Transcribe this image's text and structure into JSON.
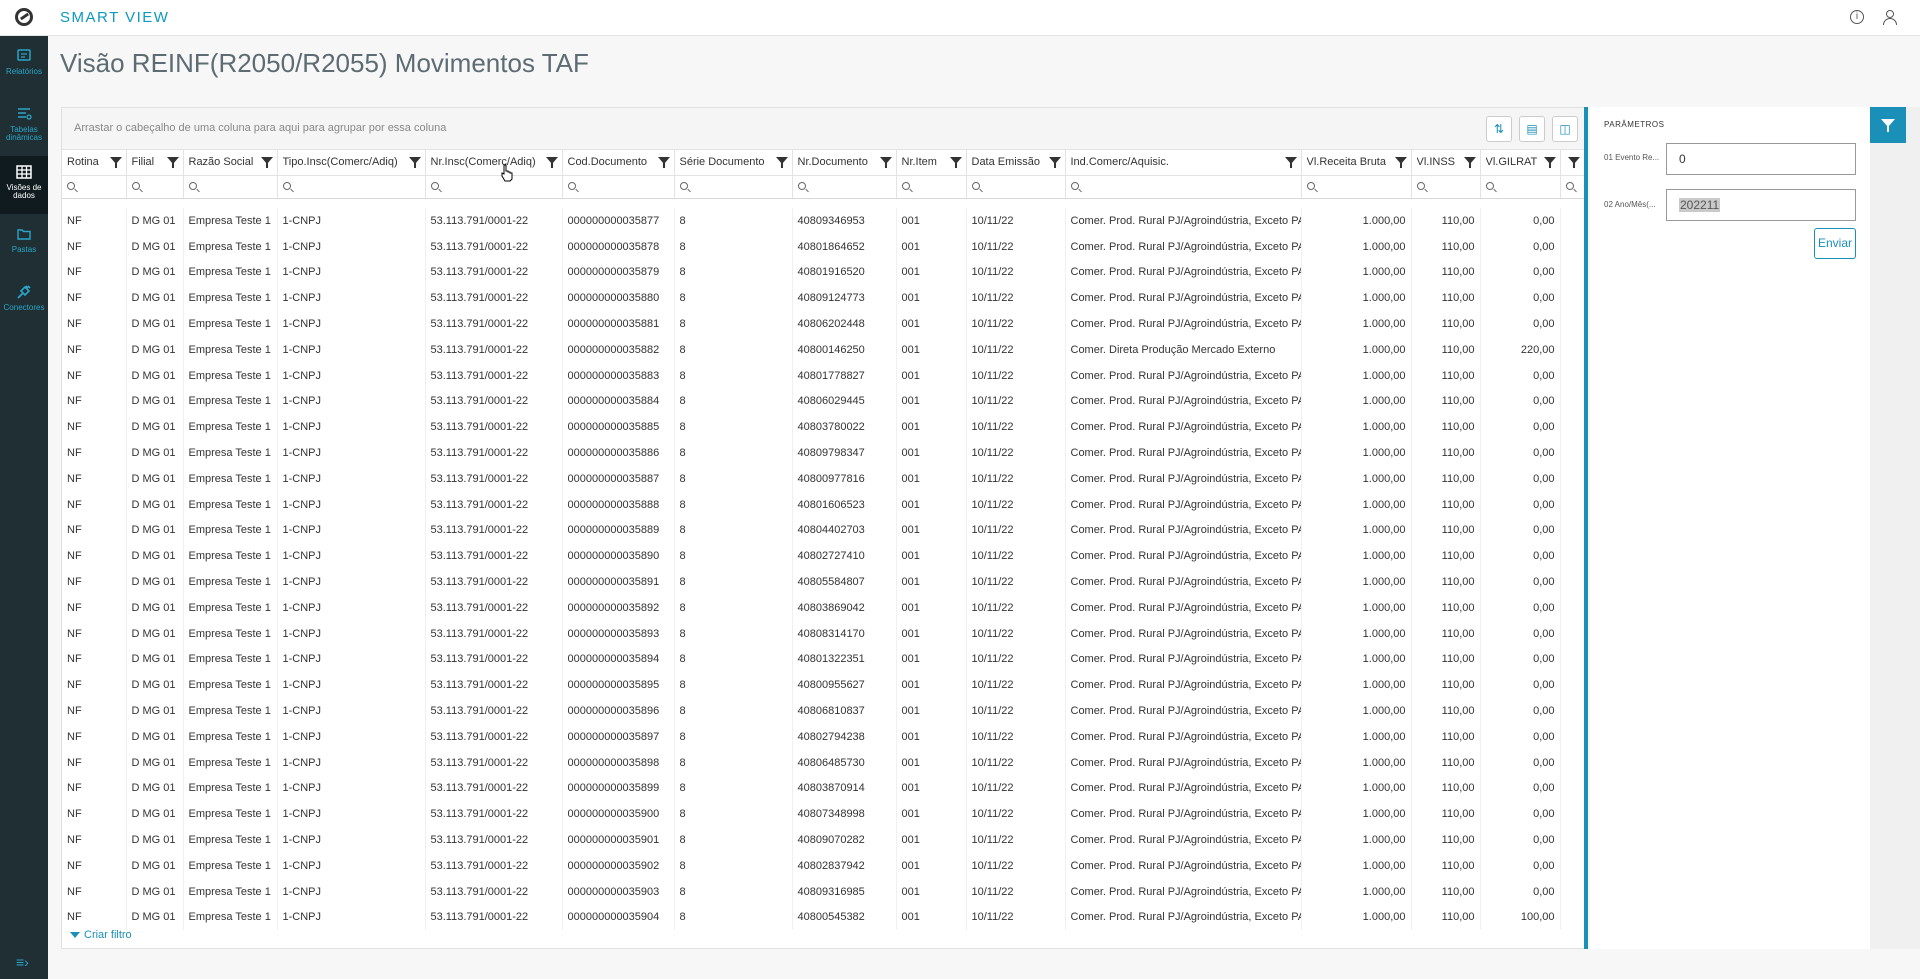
{
  "app": {
    "brand": "SMART VIEW",
    "info_icon": "info-icon",
    "user_icon": "user-icon"
  },
  "sidebar": {
    "items": [
      {
        "label": "Relatórios",
        "icon": "report-icon"
      },
      {
        "label": "Tabelas dinâmicas",
        "icon": "pivot-table-icon"
      },
      {
        "label": "Visões de dados",
        "icon": "grid-icon"
      },
      {
        "label": "Pastas",
        "icon": "folder-icon"
      },
      {
        "label": "Conectores",
        "icon": "plug-icon"
      }
    ],
    "collapse_icon": "collapse-menu-icon"
  },
  "page": {
    "title": "Visão REINF(R2050/R2055) Movimentos TAF"
  },
  "grid": {
    "group_hint": "Arrastar o cabeçalho de uma coluna para aqui para agrupar por essa coluna",
    "columns": [
      "Rotina",
      "Filial",
      "Razão Social",
      "Tipo.Insc(Comerc/Adiq)",
      "Nr.Insc(Comerc/Adiq)",
      "Cod.Documento",
      "Série Documento",
      "Nr.Documento",
      "Nr.Item",
      "Data Emissão",
      "Ind.Comerc/Aquisic.",
      "Vl.Receita Bruta",
      "Vl.INSS",
      "Vl.GILRAT"
    ],
    "rows": [
      [
        "NF",
        "D MG 01",
        "Empresa Teste 1",
        "1-CNPJ",
        "53.113.791/0001-22",
        "000000000035877",
        "8",
        "40809346953",
        "001",
        "10/11/22",
        "Comer. Prod. Rural PJ/Agroindústria, Exceto PAA;",
        "1.000,00",
        "110,00",
        "0,00"
      ],
      [
        "NF",
        "D MG 01",
        "Empresa Teste 1",
        "1-CNPJ",
        "53.113.791/0001-22",
        "000000000035878",
        "8",
        "40801864652",
        "001",
        "10/11/22",
        "Comer. Prod. Rural PJ/Agroindústria, Exceto PAA;",
        "1.000,00",
        "110,00",
        "0,00"
      ],
      [
        "NF",
        "D MG 01",
        "Empresa Teste 1",
        "1-CNPJ",
        "53.113.791/0001-22",
        "000000000035879",
        "8",
        "40801916520",
        "001",
        "10/11/22",
        "Comer. Prod. Rural PJ/Agroindústria, Exceto PAA;",
        "1.000,00",
        "110,00",
        "0,00"
      ],
      [
        "NF",
        "D MG 01",
        "Empresa Teste 1",
        "1-CNPJ",
        "53.113.791/0001-22",
        "000000000035880",
        "8",
        "40809124773",
        "001",
        "10/11/22",
        "Comer. Prod. Rural PJ/Agroindústria, Exceto PAA;",
        "1.000,00",
        "110,00",
        "0,00"
      ],
      [
        "NF",
        "D MG 01",
        "Empresa Teste 1",
        "1-CNPJ",
        "53.113.791/0001-22",
        "000000000035881",
        "8",
        "40806202448",
        "001",
        "10/11/22",
        "Comer. Prod. Rural PJ/Agroindústria, Exceto PAA;",
        "1.000,00",
        "110,00",
        "0,00"
      ],
      [
        "NF",
        "D MG 01",
        "Empresa Teste 1",
        "1-CNPJ",
        "53.113.791/0001-22",
        "000000000035882",
        "8",
        "40800146250",
        "001",
        "10/11/22",
        "Comer. Direta Produção Mercado Externo",
        "1.000,00",
        "110,00",
        "220,00"
      ],
      [
        "NF",
        "D MG 01",
        "Empresa Teste 1",
        "1-CNPJ",
        "53.113.791/0001-22",
        "000000000035883",
        "8",
        "40801778827",
        "001",
        "10/11/22",
        "Comer. Prod. Rural PJ/Agroindústria, Exceto PAA;",
        "1.000,00",
        "110,00",
        "0,00"
      ],
      [
        "NF",
        "D MG 01",
        "Empresa Teste 1",
        "1-CNPJ",
        "53.113.791/0001-22",
        "000000000035884",
        "8",
        "40806029445",
        "001",
        "10/11/22",
        "Comer. Prod. Rural PJ/Agroindústria, Exceto PAA;",
        "1.000,00",
        "110,00",
        "0,00"
      ],
      [
        "NF",
        "D MG 01",
        "Empresa Teste 1",
        "1-CNPJ",
        "53.113.791/0001-22",
        "000000000035885",
        "8",
        "40803780022",
        "001",
        "10/11/22",
        "Comer. Prod. Rural PJ/Agroindústria, Exceto PAA;",
        "1.000,00",
        "110,00",
        "0,00"
      ],
      [
        "NF",
        "D MG 01",
        "Empresa Teste 1",
        "1-CNPJ",
        "53.113.791/0001-22",
        "000000000035886",
        "8",
        "40809798347",
        "001",
        "10/11/22",
        "Comer. Prod. Rural PJ/Agroindústria, Exceto PAA;",
        "1.000,00",
        "110,00",
        "0,00"
      ],
      [
        "NF",
        "D MG 01",
        "Empresa Teste 1",
        "1-CNPJ",
        "53.113.791/0001-22",
        "000000000035887",
        "8",
        "40800977816",
        "001",
        "10/11/22",
        "Comer. Prod. Rural PJ/Agroindústria, Exceto PAA;",
        "1.000,00",
        "110,00",
        "0,00"
      ],
      [
        "NF",
        "D MG 01",
        "Empresa Teste 1",
        "1-CNPJ",
        "53.113.791/0001-22",
        "000000000035888",
        "8",
        "40801606523",
        "001",
        "10/11/22",
        "Comer. Prod. Rural PJ/Agroindústria, Exceto PAA;",
        "1.000,00",
        "110,00",
        "0,00"
      ],
      [
        "NF",
        "D MG 01",
        "Empresa Teste 1",
        "1-CNPJ",
        "53.113.791/0001-22",
        "000000000035889",
        "8",
        "40804402703",
        "001",
        "10/11/22",
        "Comer. Prod. Rural PJ/Agroindústria, Exceto PAA;",
        "1.000,00",
        "110,00",
        "0,00"
      ],
      [
        "NF",
        "D MG 01",
        "Empresa Teste 1",
        "1-CNPJ",
        "53.113.791/0001-22",
        "000000000035890",
        "8",
        "40802727410",
        "001",
        "10/11/22",
        "Comer. Prod. Rural PJ/Agroindústria, Exceto PAA;",
        "1.000,00",
        "110,00",
        "0,00"
      ],
      [
        "NF",
        "D MG 01",
        "Empresa Teste 1",
        "1-CNPJ",
        "53.113.791/0001-22",
        "000000000035891",
        "8",
        "40805584807",
        "001",
        "10/11/22",
        "Comer. Prod. Rural PJ/Agroindústria, Exceto PAA;",
        "1.000,00",
        "110,00",
        "0,00"
      ],
      [
        "NF",
        "D MG 01",
        "Empresa Teste 1",
        "1-CNPJ",
        "53.113.791/0001-22",
        "000000000035892",
        "8",
        "40803869042",
        "001",
        "10/11/22",
        "Comer. Prod. Rural PJ/Agroindústria, Exceto PAA;",
        "1.000,00",
        "110,00",
        "0,00"
      ],
      [
        "NF",
        "D MG 01",
        "Empresa Teste 1",
        "1-CNPJ",
        "53.113.791/0001-22",
        "000000000035893",
        "8",
        "40808314170",
        "001",
        "10/11/22",
        "Comer. Prod. Rural PJ/Agroindústria, Exceto PAA;",
        "1.000,00",
        "110,00",
        "0,00"
      ],
      [
        "NF",
        "D MG 01",
        "Empresa Teste 1",
        "1-CNPJ",
        "53.113.791/0001-22",
        "000000000035894",
        "8",
        "40801322351",
        "001",
        "10/11/22",
        "Comer. Prod. Rural PJ/Agroindústria, Exceto PAA;",
        "1.000,00",
        "110,00",
        "0,00"
      ],
      [
        "NF",
        "D MG 01",
        "Empresa Teste 1",
        "1-CNPJ",
        "53.113.791/0001-22",
        "000000000035895",
        "8",
        "40800955627",
        "001",
        "10/11/22",
        "Comer. Prod. Rural PJ/Agroindústria, Exceto PAA;",
        "1.000,00",
        "110,00",
        "0,00"
      ],
      [
        "NF",
        "D MG 01",
        "Empresa Teste 1",
        "1-CNPJ",
        "53.113.791/0001-22",
        "000000000035896",
        "8",
        "40806810837",
        "001",
        "10/11/22",
        "Comer. Prod. Rural PJ/Agroindústria, Exceto PAA;",
        "1.000,00",
        "110,00",
        "0,00"
      ],
      [
        "NF",
        "D MG 01",
        "Empresa Teste 1",
        "1-CNPJ",
        "53.113.791/0001-22",
        "000000000035897",
        "8",
        "40802794238",
        "001",
        "10/11/22",
        "Comer. Prod. Rural PJ/Agroindústria, Exceto PAA;",
        "1.000,00",
        "110,00",
        "0,00"
      ],
      [
        "NF",
        "D MG 01",
        "Empresa Teste 1",
        "1-CNPJ",
        "53.113.791/0001-22",
        "000000000035898",
        "8",
        "40806485730",
        "001",
        "10/11/22",
        "Comer. Prod. Rural PJ/Agroindústria, Exceto PAA;",
        "1.000,00",
        "110,00",
        "0,00"
      ],
      [
        "NF",
        "D MG 01",
        "Empresa Teste 1",
        "1-CNPJ",
        "53.113.791/0001-22",
        "000000000035899",
        "8",
        "40803870914",
        "001",
        "10/11/22",
        "Comer. Prod. Rural PJ/Agroindústria, Exceto PAA;",
        "1.000,00",
        "110,00",
        "0,00"
      ],
      [
        "NF",
        "D MG 01",
        "Empresa Teste 1",
        "1-CNPJ",
        "53.113.791/0001-22",
        "000000000035900",
        "8",
        "40807348998",
        "001",
        "10/11/22",
        "Comer. Prod. Rural PJ/Agroindústria, Exceto PAA;",
        "1.000,00",
        "110,00",
        "0,00"
      ],
      [
        "NF",
        "D MG 01",
        "Empresa Teste 1",
        "1-CNPJ",
        "53.113.791/0001-22",
        "000000000035901",
        "8",
        "40809070282",
        "001",
        "10/11/22",
        "Comer. Prod. Rural PJ/Agroindústria, Exceto PAA;",
        "1.000,00",
        "110,00",
        "0,00"
      ],
      [
        "NF",
        "D MG 01",
        "Empresa Teste 1",
        "1-CNPJ",
        "53.113.791/0001-22",
        "000000000035902",
        "8",
        "40802837942",
        "001",
        "10/11/22",
        "Comer. Prod. Rural PJ/Agroindústria, Exceto PAA;",
        "1.000,00",
        "110,00",
        "0,00"
      ],
      [
        "NF",
        "D MG 01",
        "Empresa Teste 1",
        "1-CNPJ",
        "53.113.791/0001-22",
        "000000000035903",
        "8",
        "40809316985",
        "001",
        "10/11/22",
        "Comer. Prod. Rural PJ/Agroindústria, Exceto PAA;",
        "1.000,00",
        "110,00",
        "0,00"
      ],
      [
        "NF",
        "D MG 01",
        "Empresa Teste 1",
        "1-CNPJ",
        "53.113.791/0001-22",
        "000000000035904",
        "8",
        "40800545382",
        "001",
        "10/11/22",
        "Comer. Prod. Rural PJ/Agroindústria, Exceto PAA;",
        "1.000,00",
        "110,00",
        "100,00"
      ]
    ],
    "create_filter_label": "Criar filtro"
  },
  "params": {
    "title": "PARÂMETROS",
    "fields": [
      {
        "label": "01 Evento Re...",
        "value": "0"
      },
      {
        "label": "02 Ano/Mês(...",
        "value": "202211"
      }
    ],
    "send_label": "Enviar"
  },
  "colors": {
    "accent": "#1a8fb8",
    "sidebar_bg": "#1f2f33",
    "brand": "#0c9abe"
  }
}
